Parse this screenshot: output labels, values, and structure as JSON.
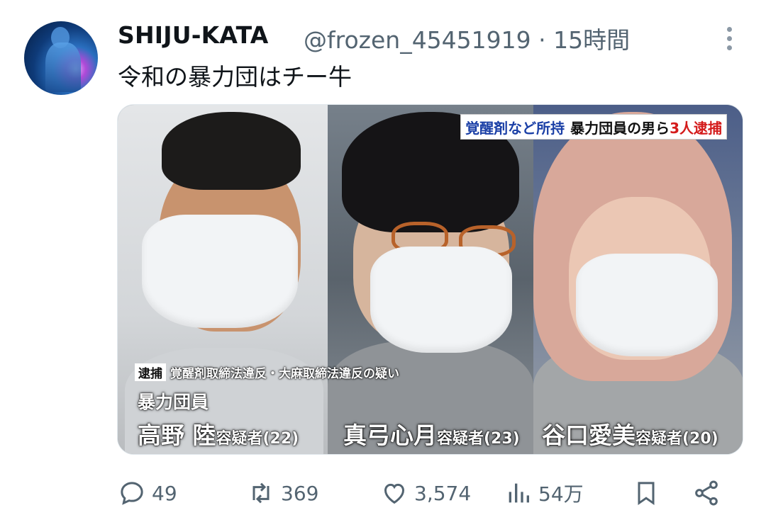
{
  "author": {
    "name": "SHIJU-KATA",
    "handle": "@frozen_45451919 · 15時間"
  },
  "tweet": {
    "text": "令和の暴力団はチー牛"
  },
  "media": {
    "headline": {
      "part1": "覚醒剤など所持",
      "part2": "暴力団員の男ら",
      "part3": "3人逮捕"
    },
    "caption_tag": "逮捕",
    "caption_text": "覚醒剤取締法違反・大麻取締法違反の疑い",
    "role": "暴力団員",
    "suspects": [
      {
        "name": "高野 陸",
        "suffix": "容疑者(22)"
      },
      {
        "name": "真弓心月",
        "suffix": "容疑者(23)"
      },
      {
        "name": "谷口愛美",
        "suffix": "容疑者(20)"
      }
    ]
  },
  "actions": {
    "replies": "49",
    "retweets": "369",
    "likes": "3,574",
    "views": "54万"
  },
  "colors": {
    "text_primary": "#0f1419",
    "text_secondary": "#536471",
    "headline_blue": "#1a3fa6",
    "headline_red": "#d41b1b"
  }
}
